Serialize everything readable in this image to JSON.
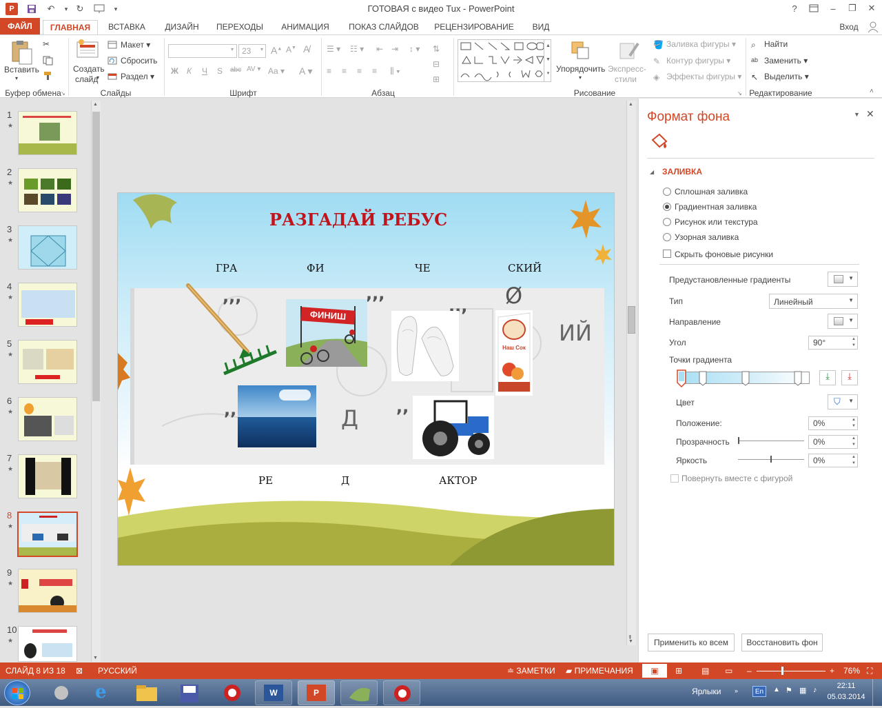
{
  "window": {
    "title": "ГОТОВАЯ с видео Tux - PowerPoint",
    "help": "?",
    "signin": "Вход"
  },
  "tabs": [
    {
      "id": "file",
      "label": "ФАЙЛ"
    },
    {
      "id": "home",
      "label": "ГЛАВНАЯ"
    },
    {
      "id": "insert",
      "label": "ВСТАВКА"
    },
    {
      "id": "design",
      "label": "ДИЗАЙН"
    },
    {
      "id": "transitions",
      "label": "ПЕРЕХОДЫ"
    },
    {
      "id": "animation",
      "label": "АНИМАЦИЯ"
    },
    {
      "id": "slideshow",
      "label": "ПОКАЗ СЛАЙДОВ"
    },
    {
      "id": "review",
      "label": "РЕЦЕНЗИРОВАНИЕ"
    },
    {
      "id": "view",
      "label": "ВИД"
    }
  ],
  "ribbon": {
    "clipboard": {
      "paste": "Вставить",
      "group": "Буфер обмена"
    },
    "slides": {
      "new_slide_1": "Создать",
      "new_slide_2": "слайд",
      "layout": "Макет",
      "reset": "Сбросить",
      "section": "Раздел",
      "group": "Слайды"
    },
    "font": {
      "size": "23",
      "bold": "Ж",
      "italic": "К",
      "underline": "Ч",
      "strike": "S",
      "group": "Шрифт"
    },
    "paragraph": {
      "group": "Абзац"
    },
    "drawing": {
      "arrange": "Упорядочить",
      "quick_styles_1": "Экспресс-",
      "quick_styles_2": "стили",
      "fill": "Заливка фигуры",
      "outline": "Контур фигуры",
      "effects": "Эффекты фигуры",
      "group": "Рисование"
    },
    "editing": {
      "find": "Найти",
      "replace": "Заменить",
      "select": "Выделить",
      "group": "Редактирование"
    }
  },
  "slides": [
    {
      "n": "1"
    },
    {
      "n": "2"
    },
    {
      "n": "3"
    },
    {
      "n": "4"
    },
    {
      "n": "5"
    },
    {
      "n": "6"
    },
    {
      "n": "7"
    },
    {
      "n": "8"
    },
    {
      "n": "9"
    },
    {
      "n": "10"
    }
  ],
  "slide": {
    "title": "РАЗГАДАЙ РЕБУС",
    "top_words": [
      "ГРА",
      "ФИ",
      "ЧЕ",
      "СКИЙ"
    ],
    "bottom_words": [
      "РЕ",
      "Д",
      "АКТОР"
    ],
    "finish_sign": "ФИНИШ",
    "juice_label": "Наш Сок",
    "big_letter_d": "Д",
    "ending": "ИЙ",
    "empty_set": "Ø",
    "quote_1": ",,,",
    "quote_2": ",,,",
    "quote_3": ",,,",
    "quote_4": ",,",
    "quote_5": ",,"
  },
  "format_pane": {
    "title": "Формат фона",
    "section": "ЗАЛИВКА",
    "options": {
      "solid": "Сплошная заливка",
      "gradient": "Градиентная заливка",
      "picture": "Рисунок или текстура",
      "pattern": "Узорная заливка"
    },
    "hide_bg": "Скрыть фоновые рисунки",
    "preset": "Предустановленные градиенты",
    "type_label": "Тип",
    "type_value": "Линейный",
    "direction": "Направление",
    "angle_label": "Угол",
    "angle_value": "90°",
    "stops": "Точки градиента",
    "color": "Цвет",
    "position_label": "Положение:",
    "position_value": "0%",
    "transparency_label": "Прозрачность",
    "transparency_value": "0%",
    "brightness_label": "Яркость",
    "brightness_value": "0%",
    "rotate_with_shape": "Повернуть вместе с фигурой",
    "apply_all": "Применить ко всем",
    "reset_bg": "Восстановить фон"
  },
  "status": {
    "slide": "СЛАЙД 8 ИЗ 18",
    "lang": "РУССКИЙ",
    "notes": "ЗАМЕТКИ",
    "comments": "ПРИМЕЧАНИЯ",
    "zoom": "76%"
  },
  "taskbar": {
    "labels": "Ярлыки",
    "lang": "En",
    "time": "22:11",
    "date": "05.03.2014"
  }
}
